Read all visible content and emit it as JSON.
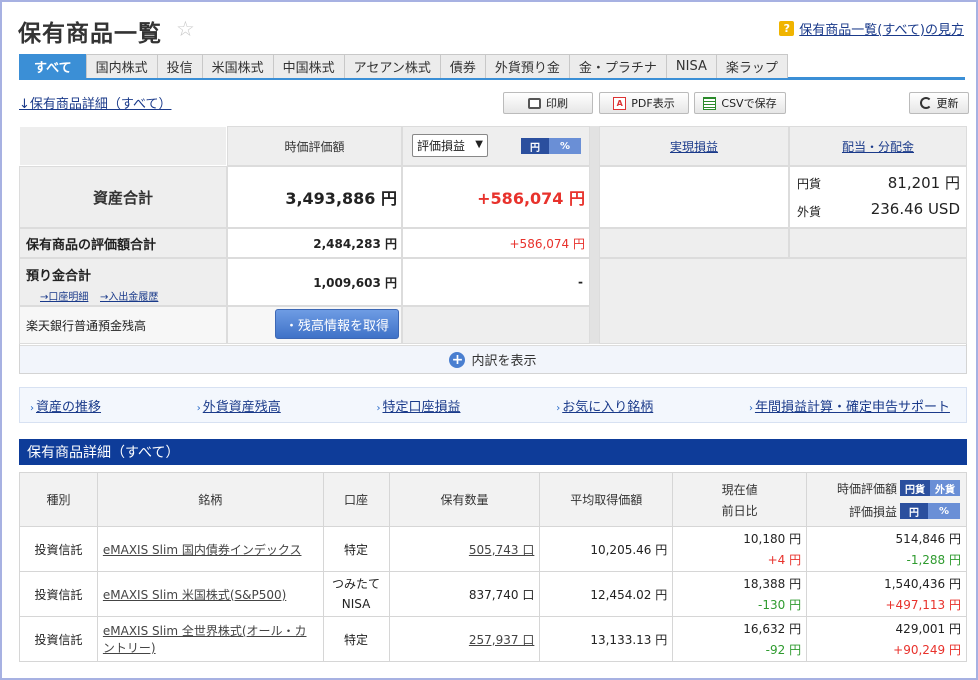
{
  "header": {
    "title": "保有商品一覧",
    "help_label": "保有商品一覧(すべて)の見方"
  },
  "tabs": [
    "すべて",
    "国内株式",
    "投信",
    "米国株式",
    "中国株式",
    "アセアン株式",
    "債券",
    "外貨預り金",
    "金・プラチナ",
    "NISA",
    "楽ラップ"
  ],
  "detail_link": "↓保有商品詳細（すべて）",
  "toolbar": {
    "print": "印刷",
    "pdf": "PDF表示",
    "csv": "CSVで保存",
    "refresh": "更新"
  },
  "summary": {
    "col_market_value": "時価評価額",
    "select_value": "評価損益",
    "toggle": [
      "円",
      "%"
    ],
    "col_realized": "実現損益",
    "col_dividend": "配当・分配金",
    "total_label": "資産合計",
    "total_value": "3,493,886 円",
    "total_pl": "+586,074 円",
    "yen_label": "円貨",
    "yen_value": "81,201 円",
    "fx_label": "外貨",
    "fx_value": "236.46 USD",
    "holdings_label": "保有商品の評価額合計",
    "holdings_value": "2,484,283 円",
    "holdings_pl": "+586,074 円",
    "deposit_label": "預り金合計",
    "deposit_value": "1,009,603 円",
    "deposit_pl": "-",
    "link_account": "→口座明細",
    "link_history": "→入出金履歴",
    "bank_label": "楽天銀行普通預金残高",
    "bank_button": "・残高情報を取得",
    "expand_label": "内訳を表示"
  },
  "quick_links": [
    "資産の推移",
    "外貨資産残高",
    "特定口座損益",
    "お気に入り銘柄",
    "年間損益計算・確定申告サポート"
  ],
  "detail_section_title": "保有商品詳細（すべて）",
  "table": {
    "headers": {
      "type": "種別",
      "name": "銘柄",
      "account": "口座",
      "qty": "保有数量",
      "avg": "平均取得価額",
      "price": "現在値",
      "prev": "前日比",
      "mv": "時価評価額",
      "pl": "評価損益",
      "cur_toggle": [
        "円貨",
        "外貨"
      ],
      "pl_toggle": [
        "円",
        "%"
      ]
    },
    "rows": [
      {
        "type": "投資信託",
        "name": "eMAXIS Slim 国内債券インデックス",
        "account": "特定",
        "qty": "505,743 口",
        "avg": "10,205.46 円",
        "price": "10,180 円",
        "change": "+4 円",
        "mv": "514,846 円",
        "pl": "-1,288 円"
      },
      {
        "type": "投資信託",
        "name": "eMAXIS Slim 米国株式(S&P500)",
        "account": "つみたて NISA",
        "qty": "837,740 口",
        "avg": "12,454.02 円",
        "price": "18,388 円",
        "change": "-130 円",
        "mv": "1,540,436 円",
        "pl": "+497,113 円"
      },
      {
        "type": "投資信託",
        "name": "eMAXIS Slim 全世界株式(オール・カントリー)",
        "account": "特定",
        "qty": "257,937 口",
        "avg": "13,133.13 円",
        "price": "16,632 円",
        "change": "-92 円",
        "mv": "429,001 円",
        "pl": "+90,249 円"
      }
    ]
  },
  "colors": {
    "accent": "#3b8fd6",
    "section": "#0e3c99",
    "positive": "#e8322c",
    "negative": "#2f9b2f"
  }
}
